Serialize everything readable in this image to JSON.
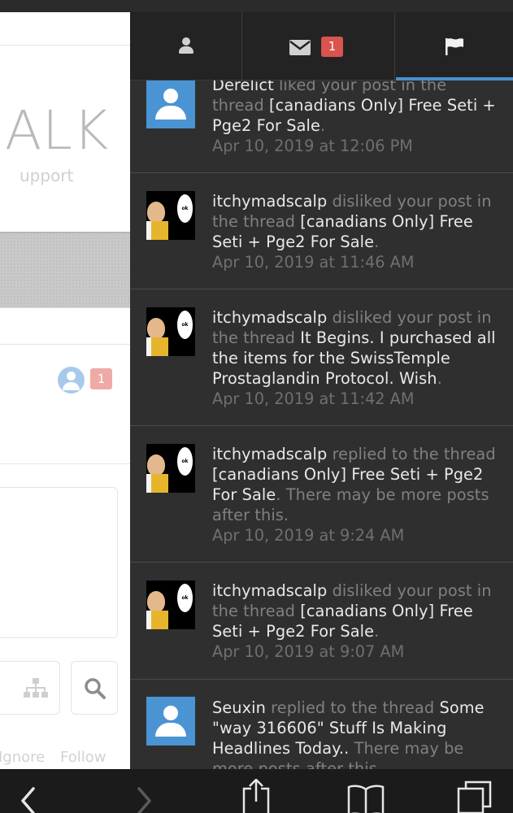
{
  "background_page": {
    "logo_text": "ALK",
    "tagline": "upport",
    "notification_count": "1",
    "ignore_label": "Ignore",
    "follow_label": "Follow"
  },
  "drawer": {
    "tabs": {
      "alerts_badge": "1"
    },
    "alerts": [
      {
        "user": "Derelict",
        "action": " liked your post in the thread ",
        "target": "[canadians Only] Free Seti + Pge2 For Sale",
        "suffix": ".",
        "date": "Apr 10, 2019 at 12:06 PM",
        "avatar": "default"
      },
      {
        "user": "itchymadscalp",
        "action": " disliked your post in the thread ",
        "target": "[canadians Only] Free Seti + Pge2 For Sale",
        "suffix": ".",
        "date": "Apr 10, 2019 at 11:46 AM",
        "avatar": "custom"
      },
      {
        "user": "itchymadscalp",
        "action": " disliked your post in the thread ",
        "target": "It Begins. I purchased all the items for the SwissTemple Prostaglandin Protocol. Wish",
        "suffix": ".",
        "date": "Apr 10, 2019 at 11:42 AM",
        "avatar": "custom"
      },
      {
        "user": "itchymadscalp",
        "action": " replied to the thread ",
        "target": "[canadians Only] Free Seti + Pge2 For Sale",
        "suffix": ". There may be more posts after this.",
        "date": "Apr 10, 2019 at 9:24 AM",
        "avatar": "custom"
      },
      {
        "user": "itchymadscalp",
        "action": " disliked your post in the thread ",
        "target": "[canadians Only] Free Seti + Pge2 For Sale",
        "suffix": ".",
        "date": "Apr 10, 2019 at 9:07 AM",
        "avatar": "custom"
      },
      {
        "user": "Seuxin",
        "action": " replied to the thread ",
        "target": "Some \"way 316606\" Stuff Is Making Headlines Today..",
        "suffix": " There may be more posts after this.",
        "date": "",
        "avatar": "default"
      }
    ]
  },
  "colors": {
    "drawer_bg": "#2f2f2f",
    "tab_active_underline": "#4a90cf",
    "badge_red": "#d9534f",
    "default_avatar": "#4a94d4"
  },
  "icons": [
    "user-icon",
    "mail-icon",
    "flag-icon",
    "back-icon",
    "forward-icon",
    "share-icon",
    "bookmarks-icon",
    "tabs-icon",
    "sitemap-icon",
    "search-icon"
  ]
}
